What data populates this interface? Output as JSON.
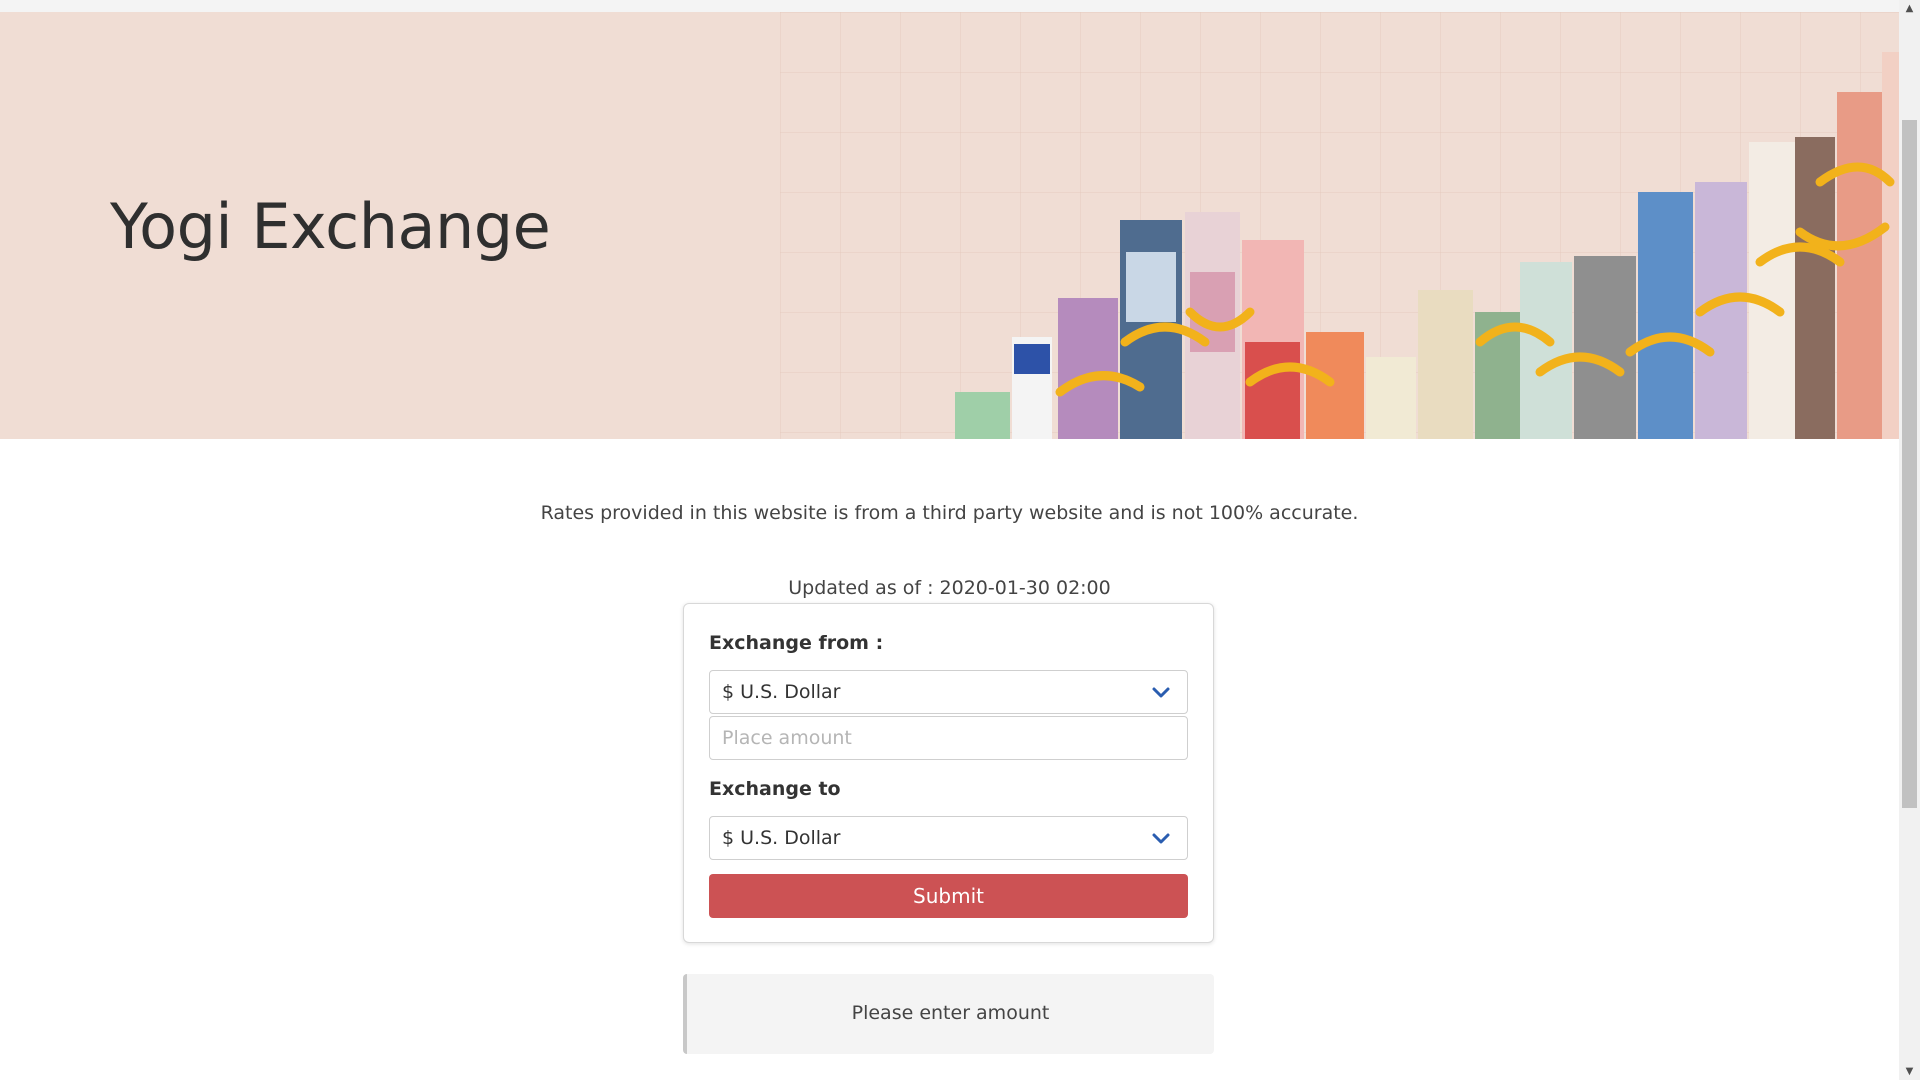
{
  "header": {
    "title": "Yogi Exchange",
    "banner_background": "#f0ddd4"
  },
  "notice": {
    "disclaimer": "Rates provided in this website is from a third party website and is not 100% accurate.",
    "updated_label": "Updated as of :",
    "updated_value": "2020-01-30 02:00"
  },
  "form": {
    "from_label": "Exchange from :",
    "from_selected": "$ U.S. Dollar",
    "amount_placeholder": "Place amount",
    "amount_value": "",
    "to_label": "Exchange to",
    "to_selected": "$ U.S. Dollar",
    "submit_label": "Submit",
    "submit_color": "#cc5254",
    "chevron_icon": "chevron-down-icon",
    "chevron_color": "#2a5db0"
  },
  "result": {
    "message": "Please enter amount"
  },
  "scrollbar": {
    "up_icon": "scroll-up-arrow-icon",
    "down_icon": "scroll-down-arrow-icon"
  }
}
